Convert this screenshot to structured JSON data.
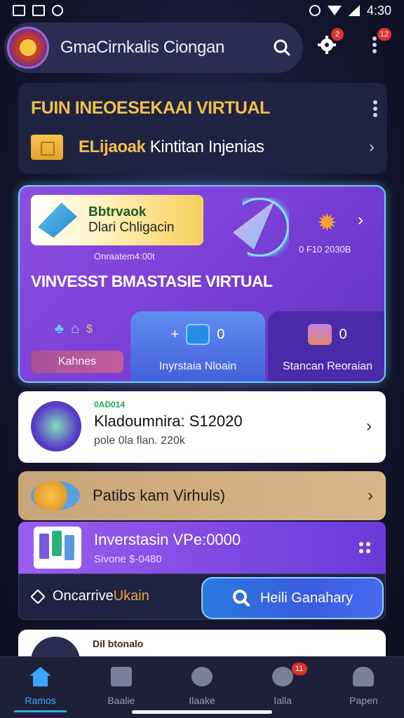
{
  "status_bar": {
    "time": "4:30"
  },
  "header": {
    "title": "GmaCirnkalis Ciongan",
    "notif_badge": "2",
    "menu_badge": "12"
  },
  "fund": {
    "title": "FUIN INEOESEKAAI VIRTUAL",
    "subtitle_highlight": "ELijaoak",
    "subtitle_rest": " Kintitan Injenias"
  },
  "virtual": {
    "promo_line1": "Bbtrvaok",
    "promo_line2": "Dlari Chligacin",
    "code": "Onraatem4:00t",
    "number": "0 F10 2030B",
    "title": "VINVESST BMASTASIE VIRTUAL",
    "tile1_label": "Kahnes",
    "tile2_label": "Inyrstaia Nloain",
    "tile2_value": "0",
    "tile3_label": "Stancan Reoraian",
    "tile3_value": "0"
  },
  "balance": {
    "tag": "0AD014",
    "main": "Kladoumnira: S12020",
    "sub": "pole 0la flan. 220k"
  },
  "feature": {
    "label": "Patibs kam Virhuls)"
  },
  "invest": {
    "main": "Inverstasin VPe:0000",
    "sub": "Sivone $-0480"
  },
  "action": {
    "left_prefix": "Oncarrive",
    "left_highlight": " Ukain",
    "button_label": "Heili Ganahary"
  },
  "partial": {
    "tag": "Dil btonalo"
  },
  "bottom_nav": {
    "items": [
      {
        "label": "Ramos",
        "active": true
      },
      {
        "label": "Baalie"
      },
      {
        "label": "Ilaake"
      },
      {
        "label": "Ialla",
        "badge": "11"
      },
      {
        "label": "Papen"
      }
    ]
  },
  "colors": {
    "accent_blue": "#3aa6ff",
    "accent_gold": "#f2c04a",
    "brand_purple": "#7a3fd6",
    "badge_red": "#e0322e"
  }
}
